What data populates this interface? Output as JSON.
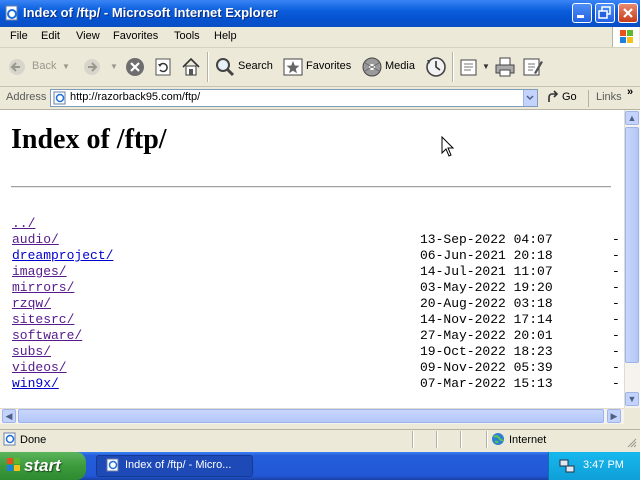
{
  "window": {
    "title": "Index of /ftp/ - Microsoft Internet Explorer"
  },
  "menu": [
    "File",
    "Edit",
    "View",
    "Favorites",
    "Tools",
    "Help"
  ],
  "toolbar": {
    "back_label": "Back",
    "search_label": "Search",
    "favorites_label": "Favorites",
    "media_label": "Media"
  },
  "address": {
    "label": "Address",
    "url": "http://razorback95.com/ftp/",
    "go_label": "Go",
    "links_label": "Links"
  },
  "page": {
    "heading": "Index of /ftp/",
    "parent_link": "../",
    "entries": [
      {
        "name": "audio/",
        "date": "13-Sep-2022 04:07",
        "size": "-"
      },
      {
        "name": "dreamproject/",
        "date": "06-Jun-2021 20:18",
        "size": "-"
      },
      {
        "name": "images/",
        "date": "14-Jul-2021 11:07",
        "size": "-"
      },
      {
        "name": "mirrors/",
        "date": "03-May-2022 19:20",
        "size": "-"
      },
      {
        "name": "rzqw/",
        "date": "20-Aug-2022 03:18",
        "size": "-"
      },
      {
        "name": "sitesrc/",
        "date": "14-Nov-2022 17:14",
        "size": "-"
      },
      {
        "name": "software/",
        "date": "27-May-2022 20:01",
        "size": "-"
      },
      {
        "name": "subs/",
        "date": "19-Oct-2022 18:23",
        "size": "-"
      },
      {
        "name": "videos/",
        "date": "09-Nov-2022 05:39",
        "size": "-"
      },
      {
        "name": "win9x/",
        "date": "07-Mar-2022 15:13",
        "size": "-"
      }
    ]
  },
  "status": {
    "text": "Done",
    "zone": "Internet"
  },
  "taskbar": {
    "start_label": "start",
    "task_label": "Index of /ftp/ - Micro...",
    "clock": "3:47 PM"
  },
  "colors": {
    "link": "#0000cc",
    "visited_link": "#551a8b",
    "titlebar": "#0a5ddc",
    "start_button": "#3c9a3c"
  }
}
